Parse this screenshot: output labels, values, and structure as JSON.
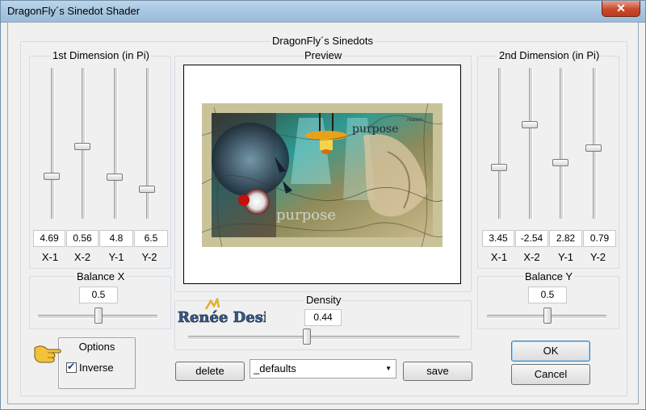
{
  "window": {
    "title": "DragonFly´s Sinedot Shader",
    "close_label": "✕"
  },
  "main_group": {
    "title": "DragonFly´s Sinedots"
  },
  "dim1": {
    "title": "1st Dimension (in Pi)",
    "values": [
      "4.69",
      "0.56",
      "4.8",
      "6.5"
    ],
    "labels": [
      "X-1",
      "X-2",
      "Y-1",
      "Y-2"
    ]
  },
  "dim2": {
    "title": "2nd Dimension (in Pi)",
    "values": [
      "3.45",
      "-2.54",
      "2.82",
      "0.79"
    ],
    "labels": [
      "X-1",
      "X-2",
      "Y-1",
      "Y-2"
    ]
  },
  "preview": {
    "title": "Preview",
    "overlay_text_top": "purpose",
    "overlay_text_bottom": "purpose",
    "overlay_text_small": "reason"
  },
  "balance_x": {
    "title": "Balance X",
    "value": "0.5"
  },
  "balance_y": {
    "title": "Balance Y",
    "value": "0.5"
  },
  "density": {
    "title": "Density",
    "value": "0.44"
  },
  "watermark": {
    "text": "Renée Design"
  },
  "options": {
    "title": "Options",
    "inverse_label": "Inverse",
    "inverse_checked": true
  },
  "buttons": {
    "delete": "delete",
    "save": "save",
    "ok": "OK",
    "cancel": "Cancel"
  },
  "preset": {
    "selected": "_defaults"
  },
  "icons": {
    "hand": "pointing-hand-icon",
    "dropdown": "chevron-down-icon",
    "close": "close-icon",
    "check": "checkmark-icon"
  }
}
